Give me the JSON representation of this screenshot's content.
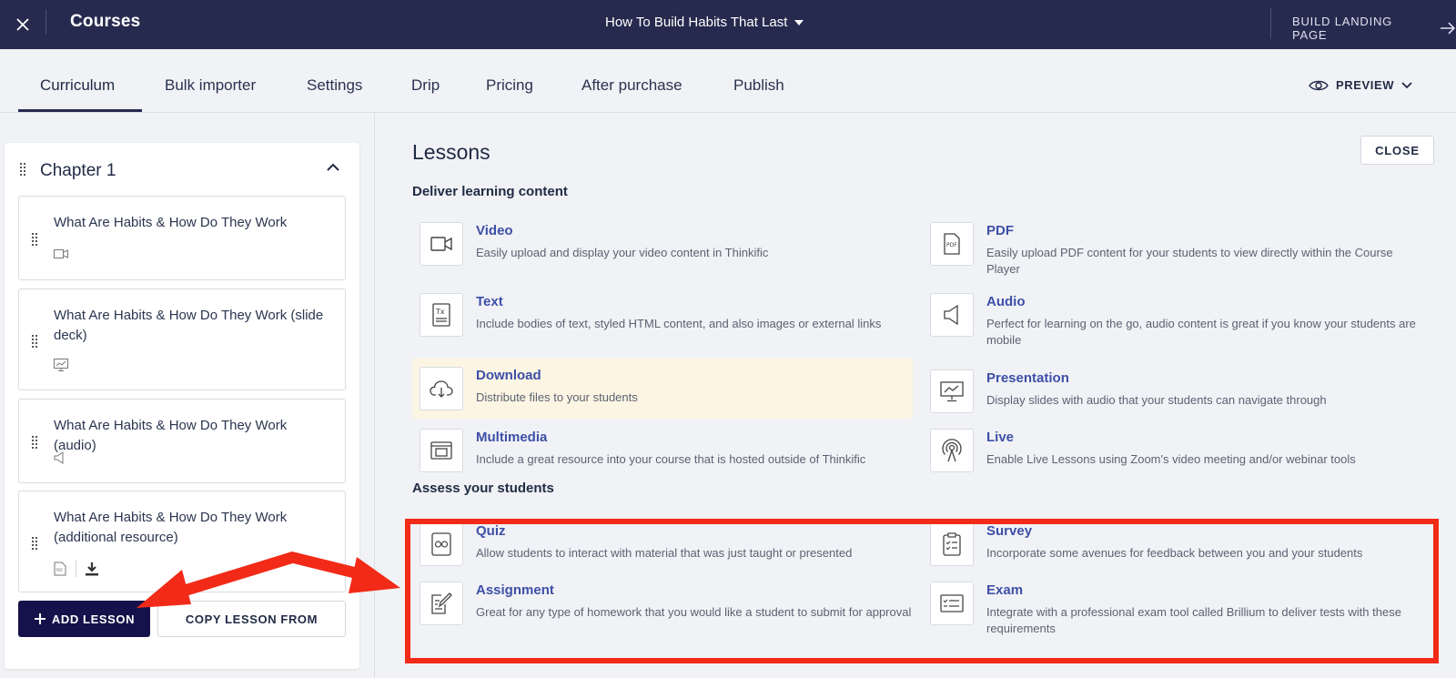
{
  "topbar": {
    "brand": "Courses",
    "course_title": "How To Build Habits That Last",
    "landing": "BUILD LANDING PAGE"
  },
  "tabs": [
    {
      "label": "Curriculum"
    },
    {
      "label": "Bulk importer"
    },
    {
      "label": "Settings"
    },
    {
      "label": "Drip"
    },
    {
      "label": "Pricing"
    },
    {
      "label": "After purchase"
    },
    {
      "label": "Publish"
    }
  ],
  "preview_label": "PREVIEW",
  "chapter": {
    "title": "Chapter 1",
    "lessons": [
      {
        "title": "What Are Habits & How Do They Work",
        "icon": "video-icon"
      },
      {
        "title": "What Are Habits & How Do They Work (slide deck)",
        "icon": "presentation-icon"
      },
      {
        "title": "What Are Habits & How Do They Work (audio)",
        "icon": "audio-icon"
      },
      {
        "title": "What Are Habits & How Do They Work (additional resource)",
        "icon": "pdf-icon"
      }
    ]
  },
  "buttons": {
    "add_lesson": "ADD LESSON",
    "copy_lesson": "COPY LESSON FROM",
    "close": "CLOSE"
  },
  "lessons_panel": {
    "title": "Lessons",
    "section_deliver": "Deliver learning content",
    "section_assess": "Assess your students",
    "deliver": [
      {
        "name": "Video",
        "desc": "Easily upload and display your video content in Thinkific",
        "icon": "video-icon"
      },
      {
        "name": "PDF",
        "desc": "Easily upload PDF content for your students to view directly within the Course Player",
        "icon": "pdf-icon"
      },
      {
        "name": "Text",
        "desc": "Include bodies of text, styled HTML content, and also images or external links",
        "icon": "text-icon"
      },
      {
        "name": "Audio",
        "desc": "Perfect for learning on the go, audio content is great if you know your students are mobile",
        "icon": "audio-icon"
      },
      {
        "name": "Download",
        "desc": "Distribute files to your students",
        "icon": "cloud-download-icon"
      },
      {
        "name": "Presentation",
        "desc": "Display slides with audio that your students can navigate through",
        "icon": "presentation-icon"
      },
      {
        "name": "Multimedia",
        "desc": "Include a great resource into your course that is hosted outside of Thinkific",
        "icon": "multimedia-icon"
      },
      {
        "name": "Live",
        "desc": "Enable Live Lessons using Zoom's video meeting and/or webinar tools",
        "icon": "live-icon"
      }
    ],
    "assess": [
      {
        "name": "Quiz",
        "desc": "Allow students to interact with material that was just taught or presented",
        "icon": "quiz-icon"
      },
      {
        "name": "Survey",
        "desc": "Incorporate some avenues for feedback between you and your students",
        "icon": "survey-icon"
      },
      {
        "name": "Assignment",
        "desc": "Great for any type of homework that you would like a student to submit for approval",
        "icon": "assignment-icon"
      },
      {
        "name": "Exam",
        "desc": "Integrate with a professional exam tool called Brillium to deliver tests with these requirements",
        "icon": "exam-icon"
      }
    ]
  },
  "colors": {
    "topbar": "#262a4e",
    "primary_button": "#15124b",
    "link_blue": "#3d4fa8",
    "highlight": "#fdf5e3",
    "annotation_red": "#f22a18"
  }
}
